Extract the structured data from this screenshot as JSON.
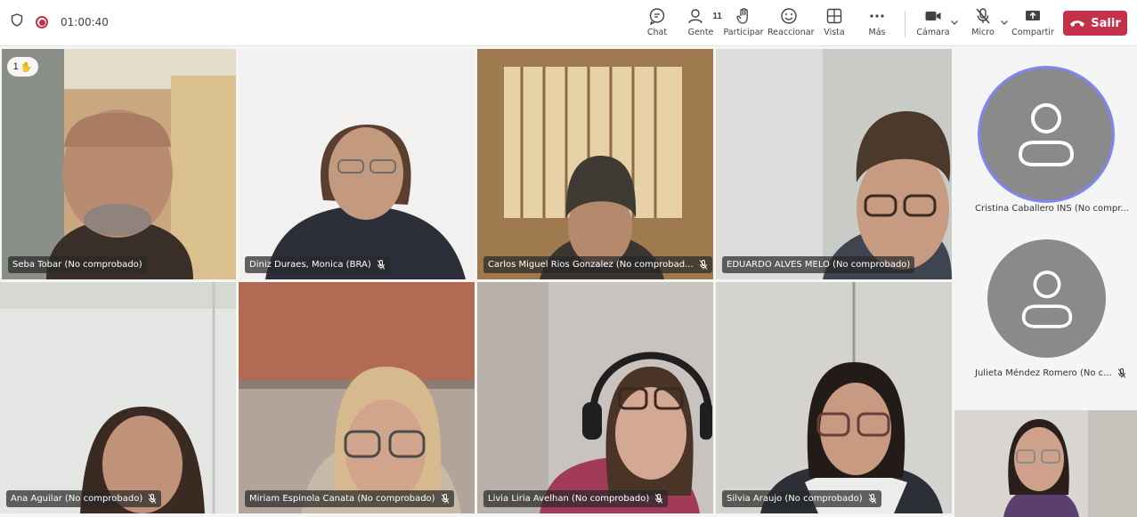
{
  "topbar": {
    "timer": "01:00:40",
    "chat": "Chat",
    "people": "Gente",
    "people_count": "11",
    "raise": "Participar",
    "react": "Reaccionar",
    "view": "Vista",
    "more": "Más",
    "camera": "Cámara",
    "mic": "Micro",
    "share": "Compartir",
    "leave": "Salir"
  },
  "hand_count": "1",
  "participants": [
    {
      "name": "Seba Tobar (No comprobado)"
    },
    {
      "name": "Diniz Duraes, Monica (BRA)"
    },
    {
      "name": "Carlos Miguel Rios Gonzalez (No comprobad..."
    },
    {
      "name": "EDUARDO ALVES MELO (No comprobado)"
    },
    {
      "name": "Ana Aguilar (No comprobado)"
    },
    {
      "name": "Miriam Espinola Canata (No comprobado)"
    },
    {
      "name": "Livia Liria Avelhan (No comprobado)"
    },
    {
      "name": "Silvia Araujo (No comprobado)"
    }
  ],
  "side_participants": [
    {
      "name": "Cristina Caballero INS (No compr..."
    },
    {
      "name": "Julieta Méndez Romero (No c..."
    }
  ],
  "colors": {
    "accent": "#7f85f5",
    "leave": "#c4314b"
  }
}
